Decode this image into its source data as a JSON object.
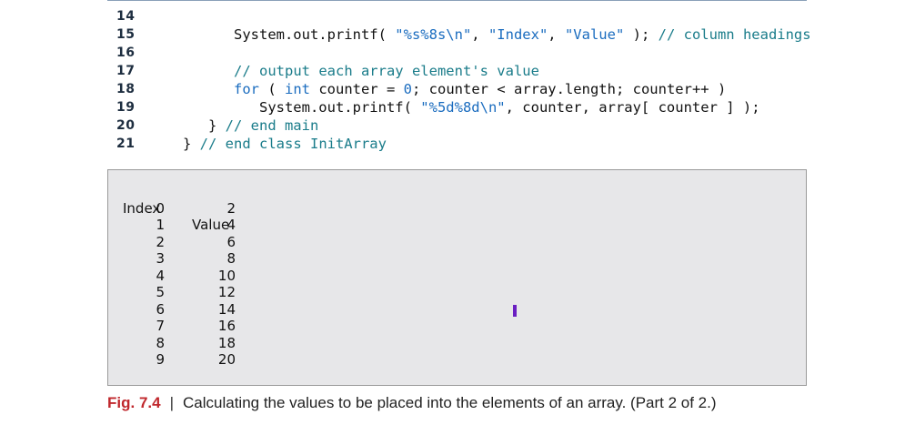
{
  "code_lines": [
    {
      "num": "14",
      "parts": []
    },
    {
      "num": "15",
      "parts": [
        {
          "t": "         System.out.printf( ",
          "c": ""
        },
        {
          "t": "\"%s%8s\\n\"",
          "c": "str"
        },
        {
          "t": ", ",
          "c": ""
        },
        {
          "t": "\"Index\"",
          "c": "str"
        },
        {
          "t": ", ",
          "c": ""
        },
        {
          "t": "\"Value\"",
          "c": "str"
        },
        {
          "t": " ); ",
          "c": ""
        },
        {
          "t": "// column headings",
          "c": "cm"
        }
      ]
    },
    {
      "num": "16",
      "parts": []
    },
    {
      "num": "17",
      "parts": [
        {
          "t": "         ",
          "c": ""
        },
        {
          "t": "// output each array element's value",
          "c": "cm"
        }
      ]
    },
    {
      "num": "18",
      "parts": [
        {
          "t": "         ",
          "c": ""
        },
        {
          "t": "for",
          "c": "kw"
        },
        {
          "t": " ( ",
          "c": ""
        },
        {
          "t": "int",
          "c": "kw"
        },
        {
          "t": " counter = ",
          "c": ""
        },
        {
          "t": "0",
          "c": "num"
        },
        {
          "t": "; counter < array.length; counter++ )",
          "c": ""
        }
      ]
    },
    {
      "num": "19",
      "parts": [
        {
          "t": "            System.out.printf( ",
          "c": ""
        },
        {
          "t": "\"%5d%8d\\n\"",
          "c": "str"
        },
        {
          "t": ", counter, array[ counter ] );",
          "c": ""
        }
      ]
    },
    {
      "num": "20",
      "parts": [
        {
          "t": "      } ",
          "c": ""
        },
        {
          "t": "// end main",
          "c": "cm"
        }
      ]
    },
    {
      "num": "21",
      "parts": [
        {
          "t": "   } ",
          "c": ""
        },
        {
          "t": "// end class InitArray",
          "c": "cm"
        }
      ]
    }
  ],
  "output": {
    "header": {
      "index": "Index",
      "value": "Value"
    },
    "rows": [
      {
        "index": "0",
        "value": "2"
      },
      {
        "index": "1",
        "value": "4"
      },
      {
        "index": "2",
        "value": "6"
      },
      {
        "index": "3",
        "value": "8"
      },
      {
        "index": "4",
        "value": "10"
      },
      {
        "index": "5",
        "value": "12"
      },
      {
        "index": "6",
        "value": "14"
      },
      {
        "index": "7",
        "value": "16"
      },
      {
        "index": "8",
        "value": "18"
      },
      {
        "index": "9",
        "value": "20"
      }
    ]
  },
  "caption": {
    "label": "Fig. 7.4",
    "separator": "|",
    "text": "Calculating the values to be placed into the elements of an array. (Part 2 of 2.)"
  },
  "colors": {
    "keyword": "#1a6cbf",
    "comment": "#1a7c8a",
    "figure_label": "#c0282d",
    "cursor": "#6a1fc2",
    "output_bg": "#e7e7e9"
  }
}
